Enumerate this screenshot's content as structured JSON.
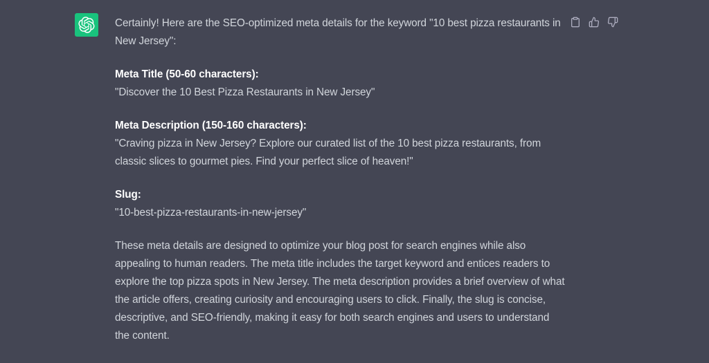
{
  "assistant": {
    "avatar_icon": "openai-logo-icon",
    "avatar_color": "#19c37d"
  },
  "message": {
    "intro": "Certainly! Here are the SEO-optimized meta details for the keyword \"10 best pizza restaurants in New Jersey\":",
    "meta_title": {
      "label": "Meta Title (50-60 characters):",
      "value": "\"Discover the 10 Best Pizza Restaurants in New Jersey\""
    },
    "meta_description": {
      "label": "Meta Description (150-160 characters):",
      "value": "\"Craving pizza in New Jersey? Explore our curated list of the 10 best pizza restaurants, from classic slices to gourmet pies. Find your perfect slice of heaven!\""
    },
    "slug": {
      "label": "Slug:",
      "value": "\"10-best-pizza-restaurants-in-new-jersey\""
    },
    "closing": "These meta details are designed to optimize your blog post for search engines while also appealing to human readers. The meta title includes the target keyword and entices readers to explore the top pizza spots in New Jersey. The meta description provides a brief overview of what the article offers, creating curiosity and encouraging users to click. Finally, the slug is concise, descriptive, and SEO-friendly, making it easy for both search engines and users to understand the content."
  },
  "actions": {
    "copy_icon": "clipboard-icon",
    "like_icon": "thumbs-up-icon",
    "dislike_icon": "thumbs-down-icon"
  },
  "colors": {
    "background": "#444654",
    "text": "#d1d5db",
    "heading": "#ffffff",
    "icon": "#acacbe"
  }
}
